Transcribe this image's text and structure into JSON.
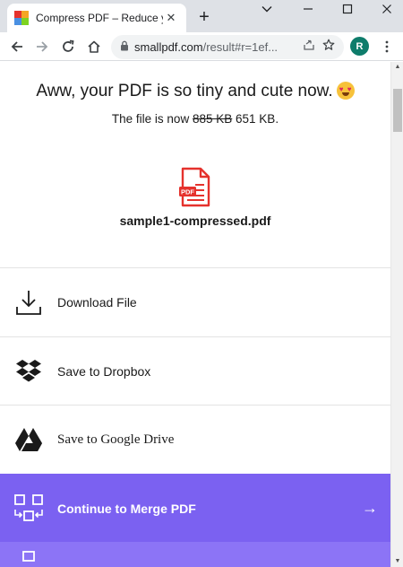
{
  "browser": {
    "tab_title": "Compress PDF – Reduce your",
    "close_glyph": "✕",
    "newtab_glyph": "+",
    "url_host": "smallpdf.com",
    "url_path": "/result#r=1ef...",
    "avatar_letter": "R",
    "icons": [
      "back-icon",
      "forward-icon",
      "reload-icon",
      "home-icon",
      "lock-icon",
      "share-icon",
      "bookmark-star-icon",
      "kebab-menu-icon",
      "window-minimize-icon",
      "window-maximize-icon",
      "window-close-icon"
    ]
  },
  "result": {
    "headline": "Aww, your PDF is so tiny and cute now.",
    "size_prefix": "The file is now",
    "old_size": "885 KB",
    "new_size": "651 KB.",
    "file_badge": "PDF",
    "filename": "sample1-compressed.pdf"
  },
  "actions": [
    {
      "label": "Download File",
      "icon": "download-icon"
    },
    {
      "label": "Save to Dropbox",
      "icon": "dropbox-icon"
    },
    {
      "label": "Save to Google Drive",
      "icon": "google-drive-icon"
    },
    {
      "label": "Continue to Merge PDF",
      "icon": "merge-pdf-icon",
      "arrow": "→"
    }
  ],
  "colors": {
    "accent": "#7b61f1",
    "accent_next": "#8c74f6",
    "pdf_red": "#e5322d",
    "avatar": "#0e7c6b"
  }
}
